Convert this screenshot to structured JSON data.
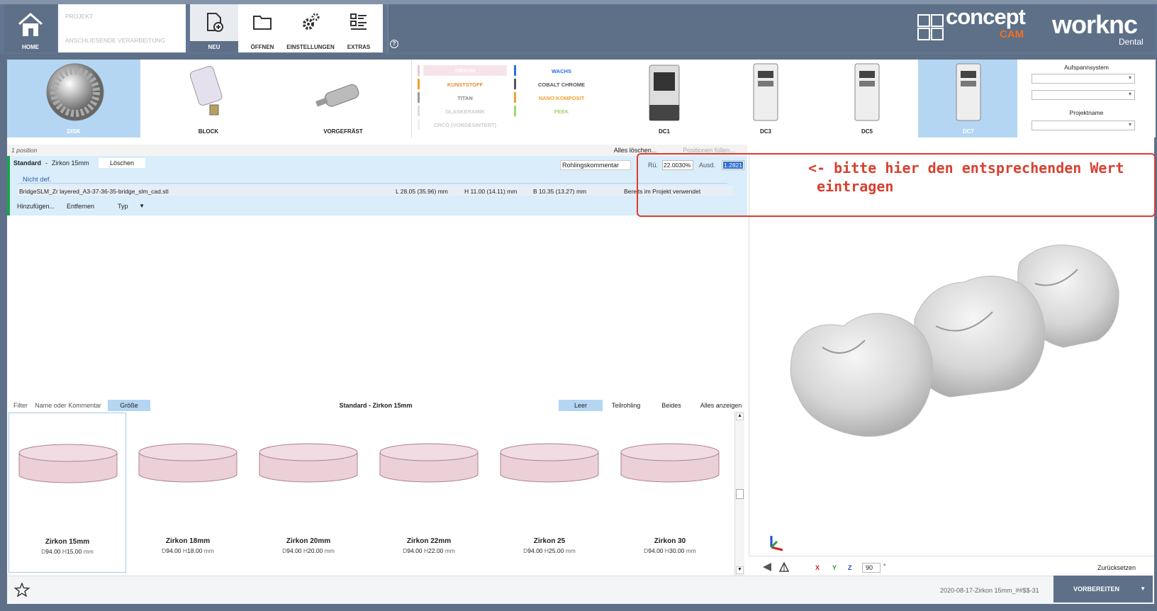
{
  "topbar": {
    "home_label": "HOME",
    "project_label": "PROJEKT",
    "postproc_label": "ANSCHLIESENDE VERARBEITUNG",
    "new_label": "NEU",
    "open_label": "ÖFFNEN",
    "settings_label": "EINSTELLUNGEN",
    "extras_label": "EXTRAS",
    "help": "?"
  },
  "logo": {
    "concept": "concept",
    "cam": "CAM",
    "worknc": "worknc",
    "dental": "Dental"
  },
  "blank_types": [
    {
      "label": "DISK",
      "selected": true
    },
    {
      "label": "BLOCK",
      "selected": false
    },
    {
      "label": "VORGEFRÄST",
      "selected": false
    }
  ],
  "materials": {
    "left": [
      {
        "label": "ZIRKON",
        "color": "#e8c8d2",
        "text_color": "#f4d6de"
      },
      {
        "label": "KUNSTSTOFF",
        "color": "#f0a030",
        "text_color": "#e09030"
      },
      {
        "label": "TITAN",
        "color": "#999999",
        "text_color": "#888888"
      },
      {
        "label": "GLASKERAMIK",
        "color": "#dddddd",
        "text_color": "#cccccc"
      },
      {
        "label": "CRCO (VORGESINTERT)",
        "color": "#eeeeee",
        "text_color": "#cccccc"
      }
    ],
    "right": [
      {
        "label": "WACHS",
        "color": "#2a6ee0",
        "text_color": "#2a6ee0"
      },
      {
        "label": "COBALT CHROME",
        "color": "#555555",
        "text_color": "#555555"
      },
      {
        "label": "NANO-KOMPOSIT",
        "color": "#f0a030",
        "text_color": "#f0a030"
      },
      {
        "label": "PEEK",
        "color": "#a8d070",
        "text_color": "#a8d070"
      }
    ]
  },
  "machines": [
    {
      "label": "DC1",
      "selected": false
    },
    {
      "label": "DC3",
      "selected": false
    },
    {
      "label": "DC5",
      "selected": false
    },
    {
      "label": "DC7",
      "selected": true
    }
  ],
  "aufspann": {
    "title": "Aufspannsystem",
    "project_name_label": "Projektname"
  },
  "positions": {
    "count_text": "1 position",
    "clear_all": "Alles löschen...",
    "fill_positions": "Positionen füllen...",
    "standard": "Standard",
    "sep": "-",
    "material": "Zirkon 15mm",
    "delete": "Löschen",
    "comment_placeholder": "Rohlingskommentar",
    "ru_label": "Rü.",
    "ru_value": "22.0030%",
    "ausd_label": "Ausd.",
    "ausd_value": "1.2821",
    "not_defined": "Nicht def.",
    "file": "BridgeSLM_Zr layered_A3-37-36-35-bridge_slm_cad.stl",
    "L": "L 28.05 (35.96) mm",
    "H": "H 11.00 (14.11) mm",
    "B": "B 10.35 (13.27) mm",
    "used": "Bereits im Projekt verwendet",
    "add": "Hinzufügen...",
    "remove": "Entfernen",
    "type": "Typ"
  },
  "annotation": "<- bitte hier den entsprechenden Wert\n eintragen",
  "filter": {
    "filter": "Filter",
    "name_comment": "Name oder Kommentar",
    "size": "Größe",
    "title": "Standard - Zirkon 15mm",
    "empty": "Leer",
    "partial": "Teilrohling",
    "both": "Beides",
    "show_all": "Alles anzeigen"
  },
  "blanks": [
    {
      "name": "Zirkon 15mm",
      "d": "D",
      "dval": "94.00",
      "h": "H",
      "hval": "15.00",
      "unit": "mm",
      "selected": true
    },
    {
      "name": "Zirkon 18mm",
      "d": "D",
      "dval": "94.00",
      "h": "H",
      "hval": "18.00",
      "unit": "mm",
      "selected": false
    },
    {
      "name": "Zirkon 20mm",
      "d": "D",
      "dval": "94.00",
      "h": "H",
      "hval": "20.00",
      "unit": "mm",
      "selected": false
    },
    {
      "name": "Zirkon 22mm",
      "d": "D",
      "dval": "94.00",
      "h": "H",
      "hval": "22.00",
      "unit": "mm",
      "selected": false
    },
    {
      "name": "Zirkon 25",
      "d": "D",
      "dval": "94.00",
      "h": "H",
      "hval": "25.00",
      "unit": "mm",
      "selected": false
    },
    {
      "name": "Zirkon 30",
      "d": "D",
      "dval": "94.00",
      "h": "H",
      "hval": "30.00",
      "unit": "mm",
      "selected": false
    }
  ],
  "view": {
    "x": "X",
    "y": "Y",
    "z": "Z",
    "angle": "90",
    "deg": "°",
    "reset": "Zurücksetzen"
  },
  "footer": {
    "project_file": "2020-08-17-Zirkon 15mm_##$$-31",
    "prepare": "VORBEREITEN"
  }
}
